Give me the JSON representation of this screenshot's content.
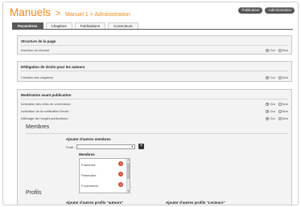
{
  "header": {
    "title_main": "Manuels",
    "title_sep": ">",
    "breadcrumb": "Manuel 1 > Administration",
    "buttons": [
      "Publication",
      "Administration"
    ]
  },
  "tabs": [
    {
      "label": "Paramètres",
      "active": true
    },
    {
      "label": "Chapitres",
      "active": false
    },
    {
      "label": "Publications",
      "active": false
    },
    {
      "label": "Correcteurs",
      "active": false
    }
  ],
  "sections": {
    "structure": {
      "title": "Structure de la page",
      "rows": [
        {
          "label": "Insertion du résumé",
          "oui": "Oui",
          "non": "Non",
          "selected": "oui"
        }
      ]
    },
    "delegation": {
      "title": "Délégation de droits pour les auteurs",
      "rows": [
        {
          "label": "Création des chapitres",
          "oui": "Oui",
          "non": "Non",
          "selected": "oui"
        }
      ]
    },
    "moderation": {
      "title": "Modération avant publication",
      "rows": [
        {
          "label": "Activation des rôles de correcteurs :",
          "oui": "Oui",
          "non": "Non",
          "selected": "oui"
        },
        {
          "label": "Activation de la notification Email :",
          "oui": "Oui",
          "non": "Non",
          "selected": "oui"
        },
        {
          "label": "Affichage de l'onglet publications :",
          "oui": "Oui",
          "non": "Non",
          "selected": "oui"
        }
      ]
    }
  },
  "membres": {
    "heading": "Membres",
    "add_title": "Ajouter d'autres membres",
    "profil_label": "Profil :",
    "profil_value": "",
    "add_button": "+",
    "list_title": "Membres",
    "list_items": [
      "Franchisé",
      "Partenaire",
      "Fournisseur"
    ]
  },
  "profils": {
    "heading": "Profils",
    "add_auteurs": "Ajouter d'autres profils \"auteurs\"",
    "add_lecteurs": "Ajouter d'autres profils \"Lecteurs\""
  }
}
